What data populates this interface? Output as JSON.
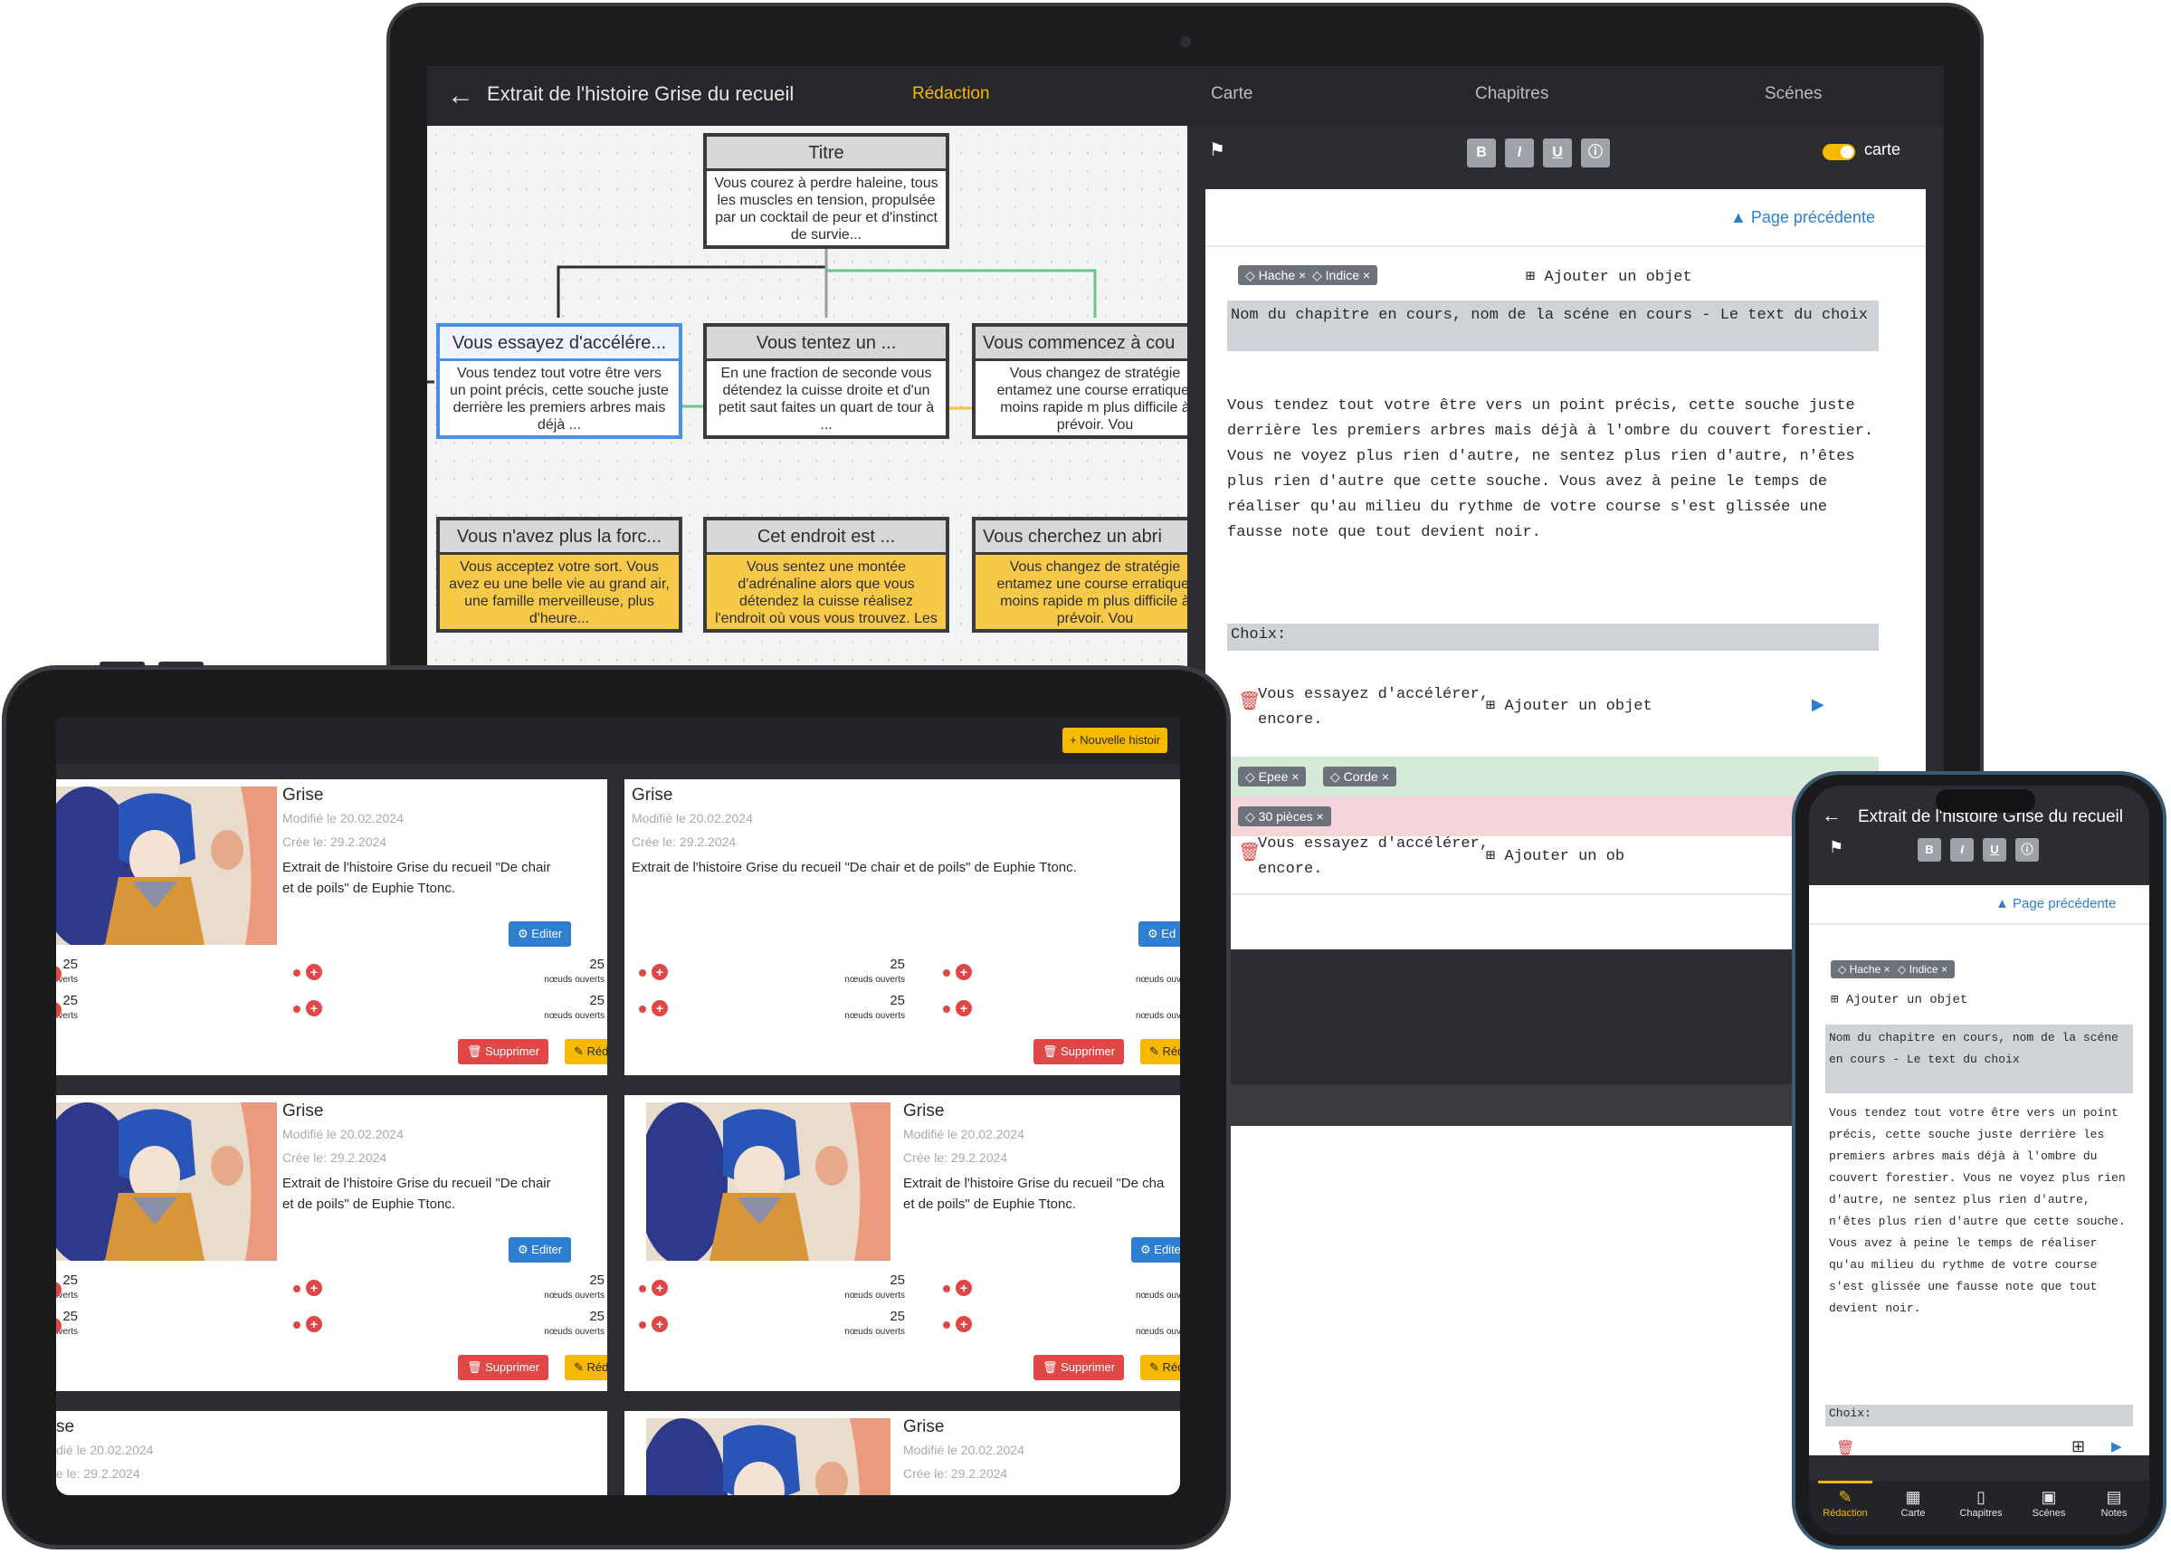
{
  "laptop": {
    "back_glyph": "←",
    "title": "Extrait de l'histoire Grise du recueil",
    "tabs": [
      "Rédaction",
      "Carte",
      "Chapitres",
      "Scénes"
    ],
    "map": {
      "root": {
        "title": "Titre",
        "body": "Vous courez à perdre haleine, tous les muscles en tension, propulsée par un cocktail de peur et d'instinct de survie..."
      },
      "row1": [
        {
          "title": "Vous essayez d'accélére...",
          "body": "Vous tendez tout votre être vers un point précis, cette souche juste derrière les premiers arbres mais déjà ..."
        },
        {
          "title": "Vous tentez un ...",
          "body": "En une fraction de seconde vous détendez la cuisse droite et d'un petit saut faites un quart de tour à ..."
        },
        {
          "title": "Vous commencez à cou",
          "body": "Vous changez de stratégie entamez une course erratique, moins rapide m plus difficile à prévoir. Vou"
        }
      ],
      "row2": [
        {
          "title": "Vous n'avez plus la forc...",
          "body": "Vous acceptez votre sort. Vous avez eu une belle vie au grand air, une famille merveilleuse, plus d'heure..."
        },
        {
          "title": "Cet endroit est ...",
          "body": "Vous sentez une montée d'adrénaline alors que vous détendez la cuisse réalisez l'endroit où vous vous trouvez. Les arbres ..."
        },
        {
          "title": "Vous cherchez un abri",
          "body": "Vous changez de stratégie entamez une course erratique, moins rapide m plus difficile à prévoir. Vou"
        }
      ]
    },
    "editor": {
      "format_buttons": [
        "B",
        "I",
        "U",
        "ⓘ"
      ],
      "toggle_label": "carte",
      "prev_page": "Page précédente",
      "chips": [
        "Hache",
        "Indice"
      ],
      "add_object": "Ajouter un objet",
      "chapter_header": "Nom du chapitre en cours, nom de la scéne en cours - Le text du choix",
      "body_text": "Vous tendez tout votre être vers un point précis, cette souche juste derrière les premiers arbres mais déjà à l'ombre du couvert forestier. Vous ne voyez plus rien d'autre, ne sentez plus rien d'autre, n'êtes plus rien d'autre que cette souche. Vous avez à peine le temps de réaliser qu'au milieu du rythme de votre course s'est glissée une fausse note que tout devient noir.",
      "choices_label": "Choix:",
      "choices": [
        {
          "text": "Vous essayez d'accélérer, encore.",
          "add": "Ajouter un objet"
        },
        {
          "text": "Vous essayez d'accélérer, encore.",
          "add": "Ajouter un ob"
        }
      ],
      "green_chips": [
        "Epee",
        "Corde"
      ],
      "red_chips": [
        "30 pièces"
      ]
    }
  },
  "tablet": {
    "new_story": "Nouvelle histoir",
    "cards": [
      {
        "title": "Grise",
        "modified": "Modifié le 20.02.2024",
        "created": "Crée le: 29.2.2024",
        "desc1": "Extrait de l'histoire Grise du recueil \"De chair",
        "desc2": "et de poils\" de Euphie Ttonc."
      },
      {
        "title": "Grise",
        "modified": "Modifié le 20.02.2024",
        "created": "Crée le: 29.2.2024",
        "desc1": "Extrait de l'histoire Grise du recueil \"De chair et de poils\" de Euphie Ttonc.",
        "desc2": ""
      },
      {
        "title": "Grise",
        "modified": "Modifié le 20.02.2024",
        "created": "Crée le: 29.2.2024",
        "desc1": "Extrait de l'histoire Grise du recueil \"De chair",
        "desc2": "et de poils\" de Euphie Ttonc."
      },
      {
        "title": "Grise",
        "modified": "Modifié le 20.02.2024",
        "created": "Crée le: 29.2.2024",
        "desc1": "Extrait de l'histoire Grise du recueil \"De cha",
        "desc2": "et de poils\" de Euphie Ttonc."
      }
    ],
    "partial_cards": [
      {
        "title": "se",
        "modified": "dié le 20.02.2024",
        "created": "e le: 29.2.2024"
      },
      {
        "title": "Grise",
        "modified": "Modifié le 20.02.2024",
        "created": "Crée le: 29.2.2024"
      }
    ],
    "edit_label": "Editer",
    "edit_label_clipped": "Ed",
    "delete_label": "Supprimer",
    "redaction_label": "Rédaction",
    "redaction_label_clipped": "Rédac",
    "stat_value": "25",
    "stat_label": "nœuds ouverts",
    "stat_label_clipped": "nœuds ouv"
  },
  "phone": {
    "back_glyph": "←",
    "title": "Extrait de l'histoire Grise du recueil",
    "format_buttons": [
      "B",
      "I",
      "U",
      "ⓘ"
    ],
    "prev_page": "Page précédente",
    "chips": [
      "Hache",
      "Indice"
    ],
    "add_object": "Ajouter un objet",
    "chapter_header": "Nom du chapitre en cours, nom de la scéne en cours - Le text du choix",
    "body_text": "Vous tendez tout votre être vers un point précis, cette souche juste derrière les premiers arbres mais déjà à l'ombre du couvert forestier. Vous ne voyez plus rien d'autre, ne sentez plus rien d'autre, n'êtes plus rien d'autre que cette souche. Vous avez à peine le temps de réaliser qu'au milieu du rythme de votre course s'est glissée une fausse note que tout devient noir.",
    "choices_label": "Choix:",
    "nav": [
      "Rédaction",
      "Carte",
      "Chapitres",
      "Scénes",
      "Notes"
    ]
  },
  "colors": {
    "accent": "#f6b900",
    "dark": "#2b2d31",
    "edit": "#2e7fd1",
    "delete": "#e04848"
  }
}
